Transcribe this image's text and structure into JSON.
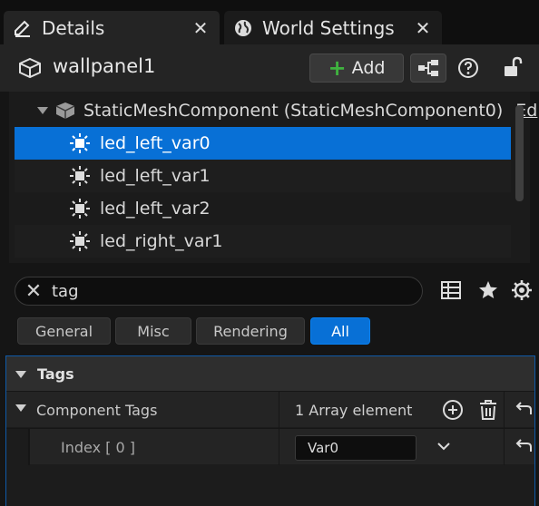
{
  "tabs": [
    {
      "label": "Details",
      "icon": "pencil-icon"
    },
    {
      "label": "World Settings",
      "icon": "globe-icon"
    }
  ],
  "header": {
    "object_name": "wallpanel1",
    "add_label": "Add"
  },
  "tree": {
    "root_label": "StaticMeshComponent (StaticMeshComponent0)",
    "root_suffix": "Ed",
    "items": [
      {
        "label": "led_left_var0",
        "selected": true
      },
      {
        "label": "led_left_var1",
        "selected": false
      },
      {
        "label": "led_left_var2",
        "selected": false
      },
      {
        "label": "led_right_var1",
        "selected": false
      }
    ]
  },
  "search": {
    "value": "tag"
  },
  "filters": [
    {
      "label": "General",
      "active": false
    },
    {
      "label": "Misc",
      "active": false
    },
    {
      "label": "Rendering",
      "active": false
    },
    {
      "label": "All",
      "active": true
    }
  ],
  "properties": {
    "category": "Tags",
    "component_tags_label": "Component Tags",
    "component_tags_value": "1 Array element",
    "index_label": "Index [ 0 ]",
    "index_value": "Var0"
  },
  "colors": {
    "selection": "#0870d6",
    "add_plus": "#3fb33f",
    "panel_bg": "#242424"
  }
}
